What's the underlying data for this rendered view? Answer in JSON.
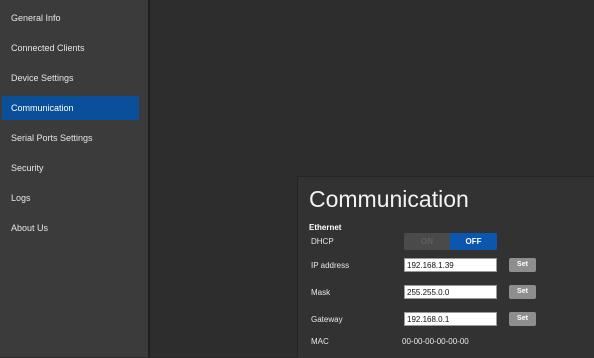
{
  "sidebar": {
    "items": [
      {
        "label": "General Info"
      },
      {
        "label": "Connected Clients"
      },
      {
        "label": "Device Settings"
      },
      {
        "label": "Communication"
      },
      {
        "label": "Serial Ports Settings"
      },
      {
        "label": "Security"
      },
      {
        "label": "Logs"
      },
      {
        "label": "About Us"
      }
    ],
    "active_index": 3
  },
  "page": {
    "title": "Communication",
    "section": "Ethernet"
  },
  "ethernet": {
    "dhcp_label": "DHCP",
    "dhcp_on": "ON",
    "dhcp_off": "OFF",
    "ip_label": "IP address",
    "ip_value": "192.168.1.39",
    "mask_label": "Mask",
    "mask_value": "255.255.0.0",
    "gateway_label": "Gateway",
    "gateway_value": "192.168.0.1",
    "set_label": "Set",
    "mac_label": "MAC",
    "mac_value": "00-00-00-00-00-00"
  },
  "colors": {
    "accent": "#0a4f9a",
    "toggle_active": "#0b57b0",
    "sidebar_bg": "#3b3b3b"
  }
}
